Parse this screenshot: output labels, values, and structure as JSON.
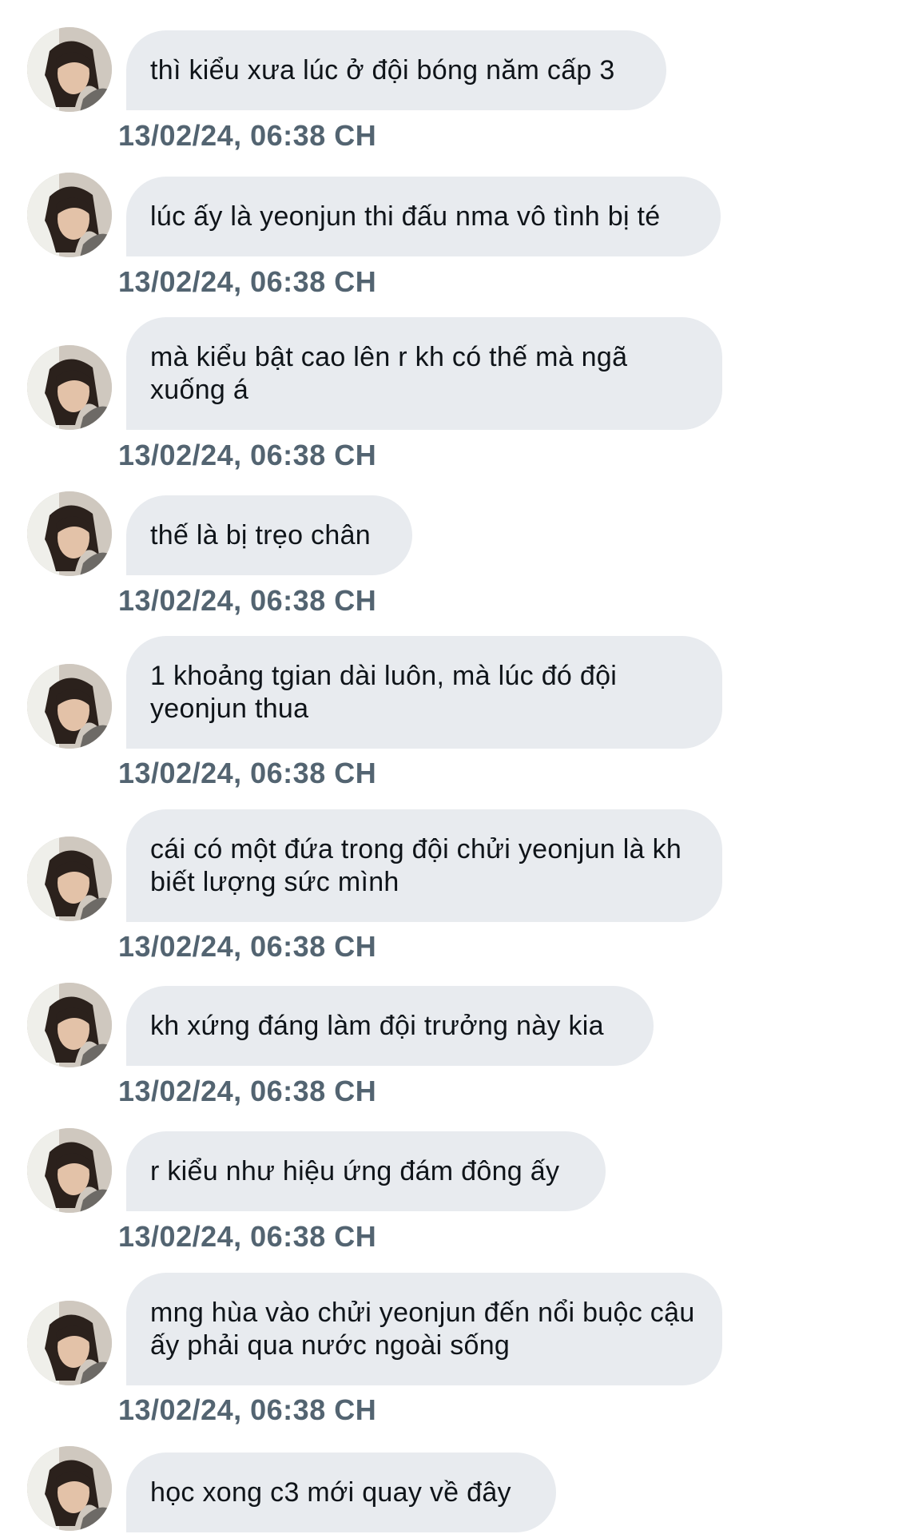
{
  "conversation": {
    "avatar_icon": "user-avatar-photo",
    "bubble_color": "#e8ebef",
    "timestamp_color": "#536471",
    "messages": [
      {
        "text": "thì kiểu xưa lúc ở đội bóng năm cấp 3",
        "time": "13/02/24, 06:38 CH"
      },
      {
        "text": "lúc ấy là yeonjun thi đấu nma vô tình bị té",
        "time": "13/02/24, 06:38 CH"
      },
      {
        "text": "mà kiểu bật cao lên r kh có thế mà ngã xuống á",
        "time": "13/02/24, 06:38 CH"
      },
      {
        "text": "thế là bị trẹo chân",
        "time": "13/02/24, 06:38 CH"
      },
      {
        "text": "1 khoảng tgian dài luôn, mà lúc đó đội yeonjun thua",
        "time": "13/02/24, 06:38 CH"
      },
      {
        "text": "cái có một đứa trong đội chửi yeonjun là kh biết lượng sức mình",
        "time": "13/02/24, 06:38 CH"
      },
      {
        "text": "kh xứng đáng làm đội trưởng này kia",
        "time": "13/02/24, 06:38 CH"
      },
      {
        "text": "r kiểu như hiệu ứng đám đông ấy",
        "time": "13/02/24, 06:38 CH"
      },
      {
        "text": "mng hùa vào chửi yeonjun đến nổi buộc cậu ấy phải qua nước ngoài sống",
        "time": "13/02/24, 06:38 CH"
      },
      {
        "text": "học xong c3 mới quay về đây",
        "time": ""
      }
    ]
  }
}
